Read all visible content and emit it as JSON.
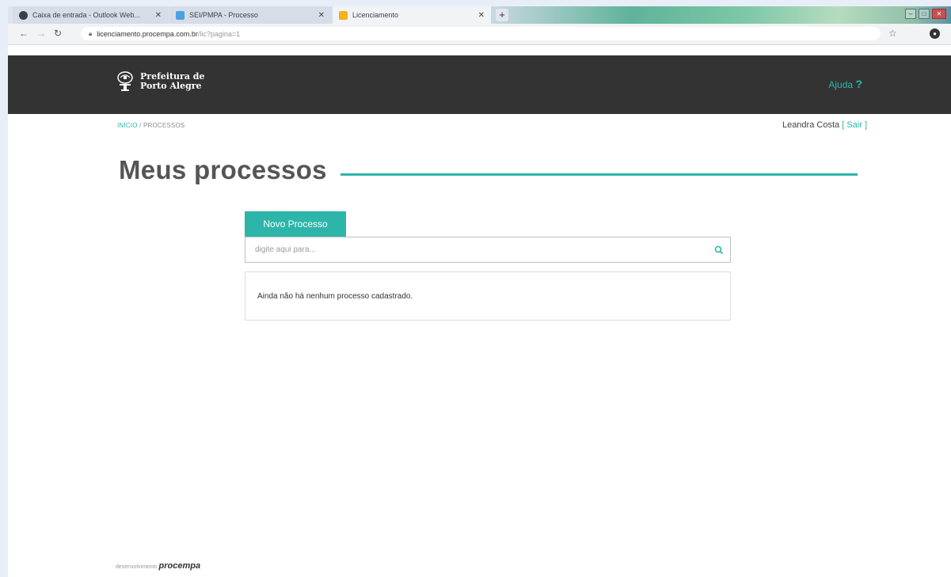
{
  "browser": {
    "tabs": [
      {
        "title": "Caixa de entrada - Outlook Web...",
        "favicon_color": "#3c4043"
      },
      {
        "title": "SEI/PMPA - Processo",
        "favicon_color": "#4aa3df"
      },
      {
        "title": "Licenciamento",
        "favicon_color": "#f2b21b"
      }
    ],
    "new_tab_label": "+",
    "url_host": "licenciamento.procempa.com.br",
    "url_path": "/lic?pagina=1"
  },
  "header": {
    "logo_line1": "Prefeitura de",
    "logo_line2": "Porto Alegre",
    "help_label": "Ajuda",
    "help_mark": "?"
  },
  "breadcrumb": {
    "home": "INÍCIO",
    "separator": "/",
    "current": "PROCESSOS"
  },
  "user": {
    "name": "Leandra Costa",
    "logout_open": "[",
    "logout_label": "Sair",
    "logout_close": "]"
  },
  "page": {
    "title": "Meus processos"
  },
  "actions": {
    "new_process": "Novo Processo"
  },
  "search": {
    "placeholder": "digite aqui para..."
  },
  "empty_message": "Ainda não há nenhum processo cadastrado.",
  "footer": {
    "dev_label": "desenvolvimento",
    "brand": "procempa"
  },
  "colors": {
    "accent": "#2db5aa",
    "header_bg": "#333333"
  }
}
